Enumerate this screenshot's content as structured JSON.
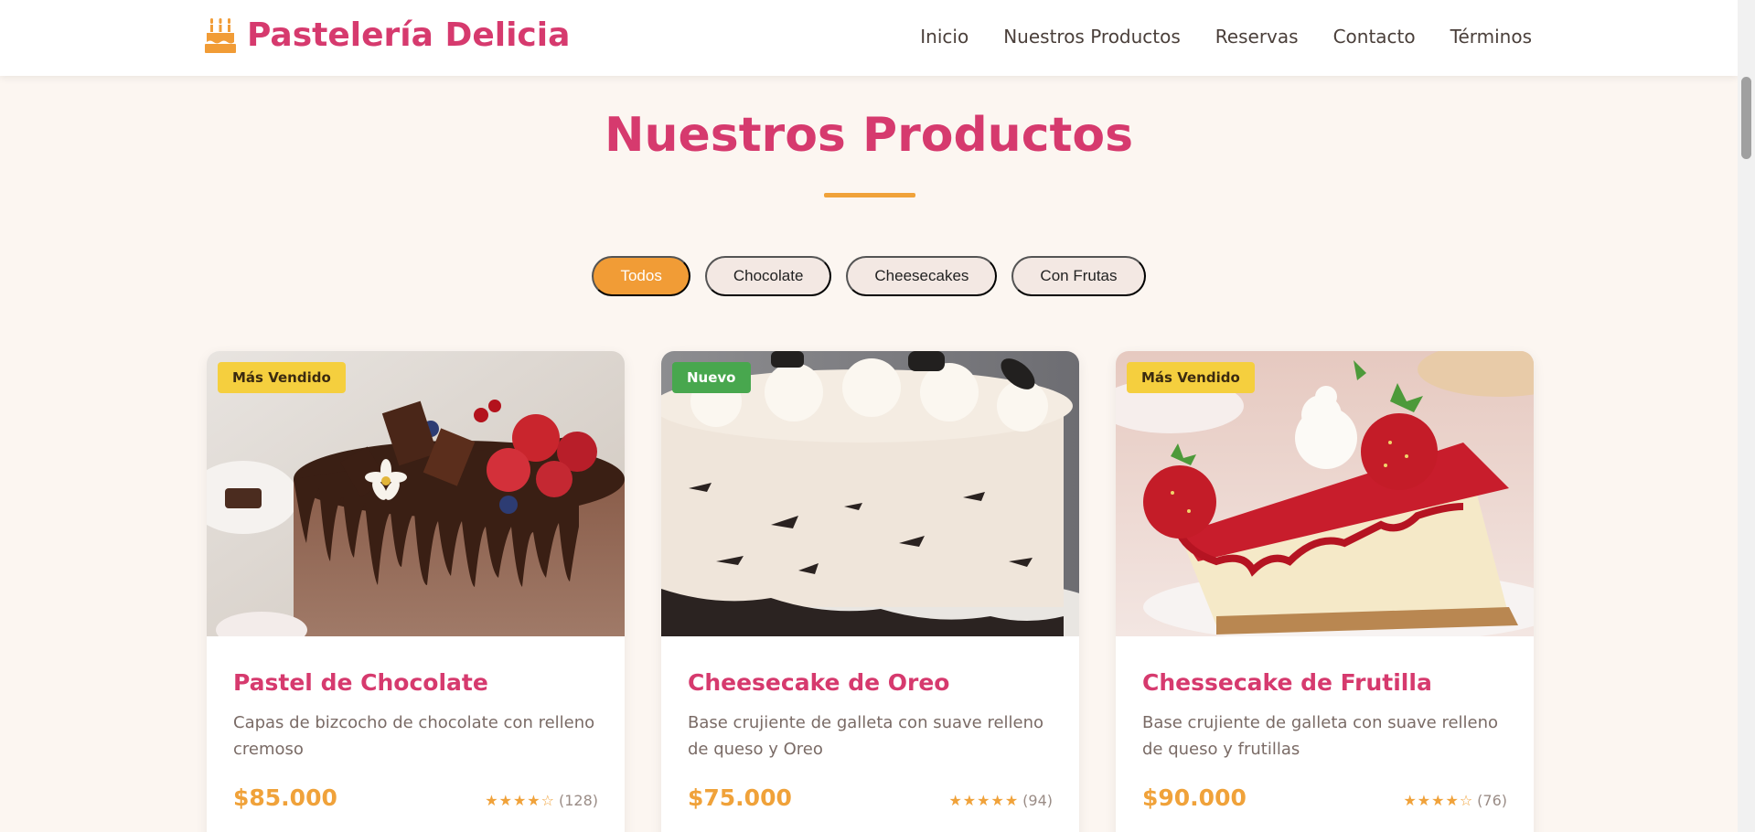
{
  "header": {
    "brand": "Pastelería Delicia",
    "brand_icon": "birthday-cake-icon",
    "nav": [
      "Inicio",
      "Nuestros Productos",
      "Reservas",
      "Contacto",
      "Términos"
    ]
  },
  "section": {
    "title": "Nuestros Productos"
  },
  "filters": [
    {
      "label": "Todos",
      "active": true
    },
    {
      "label": "Chocolate",
      "active": false
    },
    {
      "label": "Cheesecakes",
      "active": false
    },
    {
      "label": "Con Frutas",
      "active": false
    }
  ],
  "products": [
    {
      "badge": "Más Vendido",
      "badge_color": "#f5cf3e",
      "title": "Pastel de Chocolate",
      "description": "Capas de bizcocho de chocolate con relleno cremoso",
      "price": "$85.000",
      "stars": "★★★★☆",
      "rating_value": 4,
      "reviews": "(128)"
    },
    {
      "badge": "Nuevo",
      "badge_color": "#48a74e",
      "title": "Cheesecake de Oreo",
      "description": "Base crujiente de galleta con suave relleno de queso y Oreo",
      "price": "$75.000",
      "stars": "★★★★★",
      "rating_value": 5,
      "reviews": "(94)"
    },
    {
      "badge": "Más Vendido",
      "badge_color": "#f5cf3e",
      "title": "Chessecake de Frutilla",
      "description": "Base crujiente de galleta con suave relleno de queso y frutillas",
      "price": "$90.000",
      "stars": "★★★★☆",
      "rating_value": 4,
      "reviews": "(76)"
    }
  ],
  "colors": {
    "brand": "#d63a6e",
    "accent": "#f0a23a",
    "background": "#fcf6f1"
  }
}
